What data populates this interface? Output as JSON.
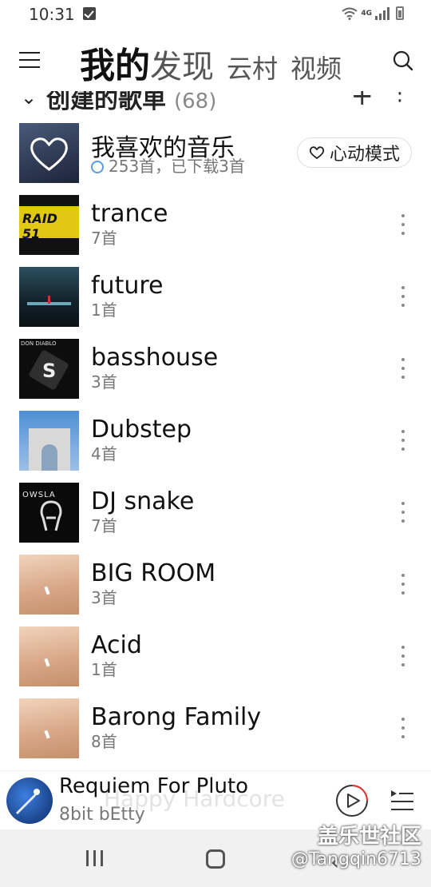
{
  "status_bar": {
    "time": "10:31",
    "network": "4G"
  },
  "header": {
    "tabs": [
      {
        "label": "我的",
        "active": true
      },
      {
        "label": "发现",
        "active": false
      },
      {
        "label": "云村",
        "active": false
      },
      {
        "label": "视频",
        "active": false
      }
    ],
    "icons": [
      "menu-icon",
      "search-icon"
    ]
  },
  "section": {
    "title": "创建的歌单",
    "count": "(68)",
    "add_label": "+"
  },
  "playlists": [
    {
      "title": "我喜欢的音乐",
      "subtitle": "253首，已下载3首",
      "mode_label": "心动模式",
      "cover_colors": [
        "#3a4a6a",
        "#1c2438"
      ]
    },
    {
      "title": "trance",
      "subtitle": "7首",
      "cover_colors": [
        "#e0c813",
        "#111111"
      ],
      "cover_text": "RAID 51"
    },
    {
      "title": "future",
      "subtitle": "1首",
      "cover_colors": [
        "#1f3a4a",
        "#0a1418"
      ]
    },
    {
      "title": "basshouse",
      "subtitle": "3首",
      "cover_colors": [
        "#0d0d0d",
        "#2a2a2a"
      ],
      "cover_text": "DON DIABLO"
    },
    {
      "title": "Dubstep",
      "subtitle": "4首",
      "cover_colors": [
        "#4f8fd4",
        "#cfd8e2"
      ]
    },
    {
      "title": "DJ snake",
      "subtitle": "7首",
      "cover_colors": [
        "#0a0a0a",
        "#1a1a1a"
      ],
      "cover_text": "OWSLA"
    },
    {
      "title": "BIG ROOM",
      "subtitle": "3首",
      "cover_colors": [
        "#e7c3a6",
        "#c48f6c"
      ]
    },
    {
      "title": "Acid",
      "subtitle": "1首",
      "cover_colors": [
        "#e7c3a6",
        "#c48f6c"
      ]
    },
    {
      "title": "Barong Family",
      "subtitle": "8首",
      "cover_colors": [
        "#e7c3a6",
        "#c48f6c"
      ]
    }
  ],
  "mini_player": {
    "title": "Requiem For Pluto",
    "artist": "8bit bEtty",
    "ghost_text": "Happy Hardcore",
    "play_accent": "#e53935"
  },
  "watermark": {
    "site": "盖乐世社区",
    "user": "@Tangqin6713"
  }
}
